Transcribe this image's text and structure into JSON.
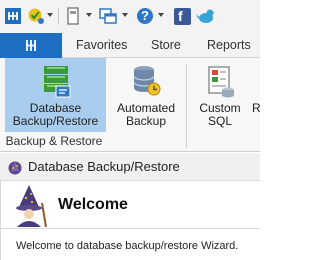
{
  "quick_access_toolbar": {
    "items": [
      {
        "icon": "home-icon"
      },
      {
        "icon": "checkmark-shield-icon"
      },
      {
        "icon": "form-icon"
      },
      {
        "icon": "windows-icon"
      },
      {
        "icon": "help-icon"
      },
      {
        "icon": "facebook-icon",
        "glyph": "f"
      },
      {
        "icon": "bird-icon"
      }
    ],
    "help_glyph": "?"
  },
  "ribbon_tabs": {
    "home_icon": "app-home-icon",
    "items": [
      {
        "label": "Favorites"
      },
      {
        "label": "Store"
      },
      {
        "label": "Reports"
      }
    ]
  },
  "ribbon": {
    "buttons": [
      {
        "label": "Database\nBackup/Restore",
        "icon": "server-database-icon",
        "active": true
      },
      {
        "label": "Automated\nBackup",
        "icon": "database-stack-icon",
        "active": false
      },
      {
        "label": "Custom\nSQL",
        "icon": "sql-document-icon",
        "active": false
      },
      {
        "label": "R",
        "icon": "",
        "active": false
      }
    ],
    "group_label": "Backup & Restore"
  },
  "wizard": {
    "window_title": "Database Backup/Restore",
    "window_icon": "wizard-hat-icon",
    "heading": "Welcome",
    "wizard_icon": "wizard-icon",
    "message": "Welcome to database backup/restore Wizard."
  },
  "colors": {
    "accent": "#1e6fc4",
    "active_button": "#a9cdee",
    "toolbar_bg": "#f3f3f3"
  }
}
